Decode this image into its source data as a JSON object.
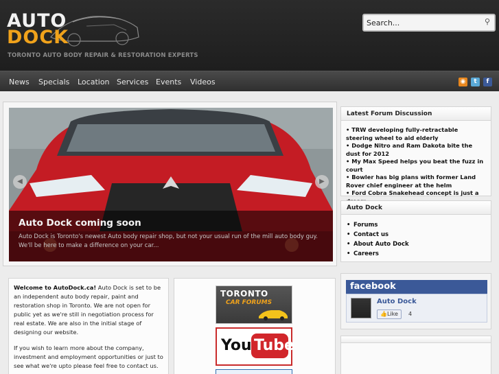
{
  "header": {
    "logo_top": "AUTO",
    "logo_bottom": "DOCK",
    "tagline": "TORONTO AUTO BODY REPAIR & RESTORATION EXPERTS",
    "search_placeholder": "Search..."
  },
  "nav": {
    "items": [
      {
        "label": "News"
      },
      {
        "label": "Specials"
      },
      {
        "label": "Location"
      },
      {
        "label": "Services"
      },
      {
        "label": "Events"
      },
      {
        "label": "Videos"
      }
    ],
    "social": [
      "rss-icon",
      "twitter-icon",
      "facebook-icon"
    ]
  },
  "slider": {
    "title": "Auto Dock coming soon",
    "text": "Auto Dock is Toronto's newest Auto body repair shop, but not your usual run of the mill auto body guy. We'll be here to make a difference on your car...",
    "prev_icon": "chevron-left-icon",
    "next_icon": "chevron-right-icon"
  },
  "forum": {
    "title": "Latest Forum Discussion",
    "items": [
      "• TRW developing fully-retractable steering wheel to aid elderly",
      "• Dodge Nitro and Ram Dakota bite the dust for 2012",
      "• My Max Speed helps you beat the fuzz in court",
      "• Bowler has big plans with former Land Rover chief engineer at the helm",
      "• Ford Cobra Snakehead concept is just a dream"
    ]
  },
  "autodock": {
    "title": "Auto Dock",
    "items": [
      "Forums",
      "Contact us",
      "About Auto Dock",
      "Careers"
    ]
  },
  "facebook": {
    "logo": "facebook",
    "page_name": "Auto Dock",
    "like_label": "Like",
    "count": "4"
  },
  "welcome": {
    "bold": "Welcome to AutoDock.ca!",
    "p1": " Auto Dock is set to be an independent auto body repair, paint and restoration shop in Toronto. We are not open for public yet as we're still in negotiation process for real estate. We are also in the initial stage of designing our website.",
    "p2": "If you wish to learn more about the company, investment and employment opportunities or just to see what we're upto please feel free to contact us."
  },
  "banners": {
    "toronto_line1": "TORONTO",
    "toronto_line2": "CAR FORUMS",
    "yt_you": "You",
    "yt_tube": "Tube"
  },
  "colors": {
    "accent": "#f0a21b",
    "facebook": "#3b5998",
    "youtube": "#d1262b"
  }
}
